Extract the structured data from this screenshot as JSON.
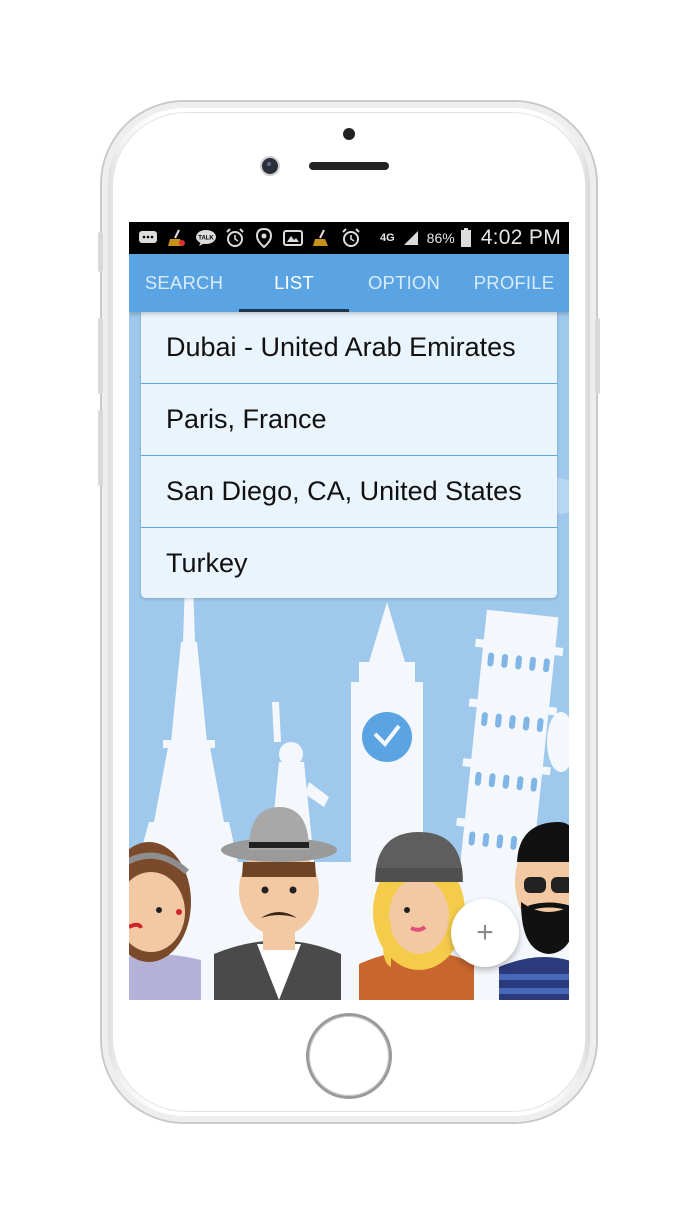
{
  "status_bar": {
    "network": "4G",
    "battery": "86%",
    "time": "4:02 PM",
    "icons": [
      "chat-bubble-icon",
      "broom-icon",
      "talk-icon",
      "alarm-icon",
      "location-icon",
      "gallery-icon",
      "broom-icon",
      "alarm-icon",
      "signal-icon",
      "battery-icon"
    ],
    "talk_badge": "TALK"
  },
  "tabs": [
    {
      "label": "SEARCH",
      "active": false
    },
    {
      "label": "LIST",
      "active": true
    },
    {
      "label": "OPTION",
      "active": false
    },
    {
      "label": "PROFILE",
      "active": false
    }
  ],
  "destinations": [
    "Dubai - United Arab Emirates",
    "Paris, France",
    "San Diego, CA, United States",
    "Turkey"
  ],
  "fab": {
    "icon": "plus-icon",
    "label": "+"
  },
  "colors": {
    "tab_bar": "#5aa4e3",
    "tab_indicator": "#1f3550",
    "list_background": "#e8f3fc",
    "divider": "#5aa4e3",
    "sky": "#9ec8ec"
  }
}
